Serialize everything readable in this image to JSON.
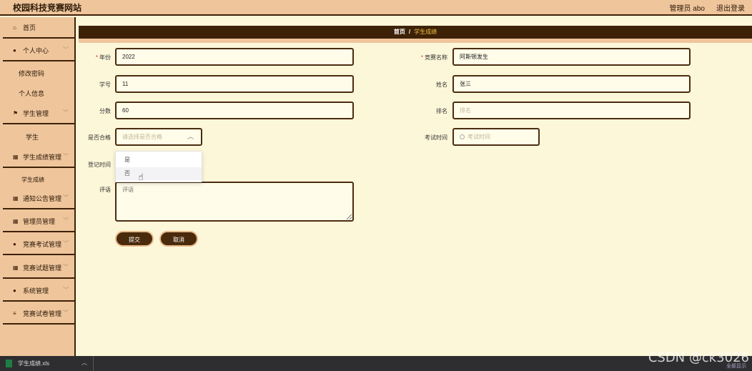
{
  "header": {
    "site_title": "校园科技竞赛网站",
    "admin_label": "管理员 abo",
    "logout": "退出登录"
  },
  "sidebar": {
    "items": [
      {
        "label": "首页",
        "icon": "home-icon",
        "glyph": "⌂"
      },
      {
        "label": "个人中心",
        "icon": "user-icon",
        "glyph": "●"
      },
      {
        "label": "修改密码"
      },
      {
        "label": "个人信息"
      },
      {
        "label": "学生管理",
        "icon": "flag-icon",
        "glyph": "⚑"
      },
      {
        "label": "学生"
      },
      {
        "label": "学生成绩管理",
        "icon": "grid-icon",
        "glyph": "▦"
      },
      {
        "label": "学生成绩"
      },
      {
        "label": "通知公告管理",
        "icon": "grid-icon",
        "glyph": "▦"
      },
      {
        "label": "管理员管理",
        "icon": "grid-icon",
        "glyph": "▦"
      },
      {
        "label": "竞赛考试管理",
        "icon": "circle-icon",
        "glyph": "●"
      },
      {
        "label": "竞赛试题管理",
        "icon": "grid-icon",
        "glyph": "▦"
      },
      {
        "label": "系统管理",
        "icon": "user-icon",
        "glyph": "●"
      },
      {
        "label": "竞赛试卷管理",
        "icon": "list-icon",
        "glyph": "≡"
      }
    ]
  },
  "breadcrumb": {
    "home": "首页",
    "sep": "/",
    "current": "学生成绩"
  },
  "form": {
    "year": {
      "label": "年份",
      "value": "2022"
    },
    "competition_name": {
      "label": "竞赛名称",
      "value": "阿斯顿发生"
    },
    "student_id": {
      "label": "学号",
      "value": "11"
    },
    "name": {
      "label": "姓名",
      "value": "张三"
    },
    "score": {
      "label": "分数",
      "value": "60"
    },
    "rank": {
      "label": "排名",
      "placeholder": "排名"
    },
    "passed": {
      "label": "是否合格",
      "placeholder": "请选择是否合格",
      "options": [
        "是",
        "否"
      ]
    },
    "exam_time": {
      "label": "考试时间",
      "placeholder": "考试时间"
    },
    "register_time": {
      "label": "登记时间"
    },
    "comment": {
      "label": "评语",
      "placeholder": "评语"
    }
  },
  "buttons": {
    "submit": "提交",
    "cancel": "取消"
  },
  "taskbar": {
    "file_name": "学生成绩.xls",
    "show_all": "全部显示"
  },
  "watermark": "CSDN @ck3026",
  "colors": {
    "primary": "#3d2208",
    "sidebar_bg": "#efc59c",
    "content_bg": "#fdf7d9",
    "breadcrumb_current": "#f0c040"
  }
}
